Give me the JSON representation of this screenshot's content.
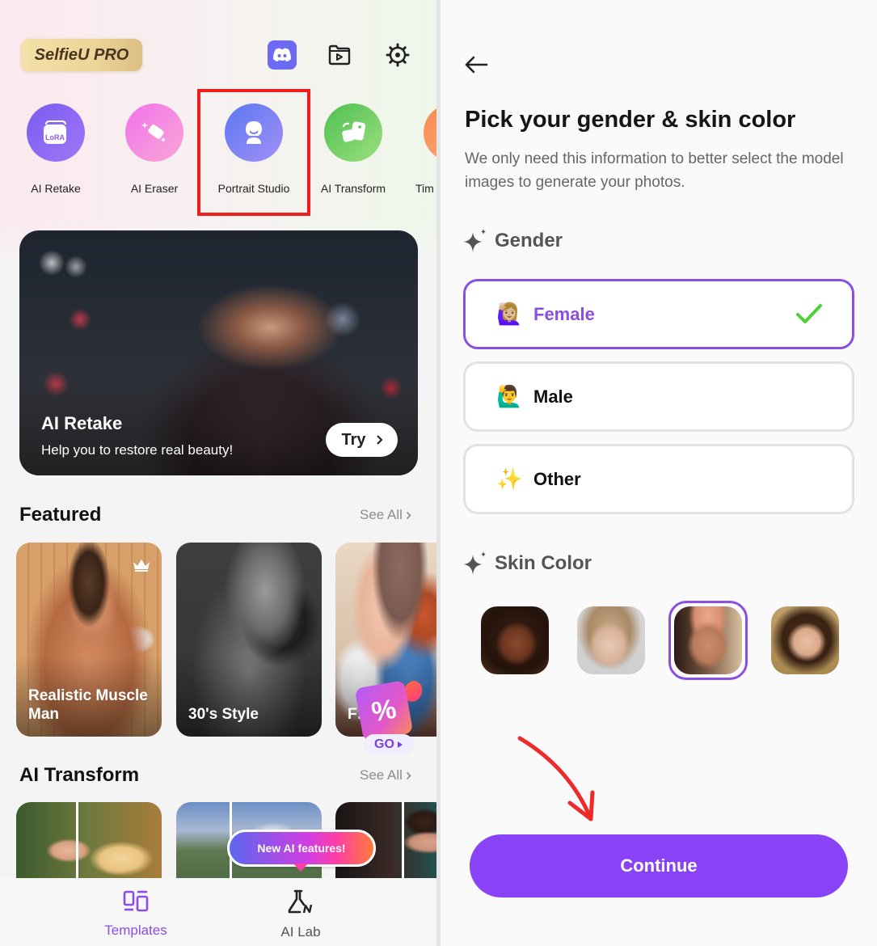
{
  "left_screen": {
    "header": {
      "pro_badge": "SelfieU PRO",
      "icons": [
        "discord-icon",
        "folder-play-icon",
        "settings-gear-icon"
      ]
    },
    "quick_tools": [
      {
        "label": "AI Retake",
        "icon": "lora-icon",
        "color": "#8a5cf0"
      },
      {
        "label": "AI Eraser",
        "icon": "eraser-icon",
        "color": "#f07ee6"
      },
      {
        "label": "Portrait Studio",
        "icon": "portrait-icon",
        "color": "#7a7cf5",
        "highlighted": true
      },
      {
        "label": "AI Transform",
        "icon": "transform-icon",
        "color": "#5cc45a"
      },
      {
        "label": "Tim",
        "icon": "partial-icon",
        "color": "#f7925a"
      }
    ],
    "hero_banner": {
      "title": "AI Retake",
      "subtitle": "Help you to restore real beauty!",
      "button_label": "Try"
    },
    "featured": {
      "title": "Featured",
      "see_all": "See All",
      "cards": [
        {
          "label": "Realistic Muscle Man",
          "premium": true
        },
        {
          "label": "30's Style",
          "premium": false
        },
        {
          "label": "F… An…",
          "premium": false
        }
      ]
    },
    "promo": {
      "symbol": "%",
      "go_label": "GO"
    },
    "ai_transform": {
      "title": "AI Transform",
      "see_all": "See All"
    },
    "tooltip": "New AI features!",
    "bottom_nav": [
      {
        "label": "Templates",
        "icon": "templates-icon",
        "active": true
      },
      {
        "label": "AI Lab",
        "icon": "flask-icon",
        "active": false
      }
    ]
  },
  "right_screen": {
    "title": "Pick your gender & skin color",
    "subtitle": "We only need this information to better select the model images to generate your photos.",
    "gender_section": {
      "heading": "Gender",
      "options": [
        {
          "label": "Female",
          "emoji": "🙋🏼‍♀️",
          "selected": true
        },
        {
          "label": "Male",
          "emoji": "🙋‍♂️",
          "selected": false
        },
        {
          "label": "Other",
          "emoji": "✨",
          "selected": false
        }
      ]
    },
    "skin_section": {
      "heading": "Skin Color",
      "options": [
        {
          "name": "dark",
          "selected": false
        },
        {
          "name": "fair",
          "selected": false
        },
        {
          "name": "medium",
          "selected": true
        },
        {
          "name": "light-warm",
          "selected": false
        }
      ]
    },
    "continue_label": "Continue"
  },
  "colors": {
    "accent_purple": "#8a42f7",
    "selected_border": "#8a4ee0",
    "check_green": "#4cd137",
    "annotation_red": "#f01d1d"
  }
}
